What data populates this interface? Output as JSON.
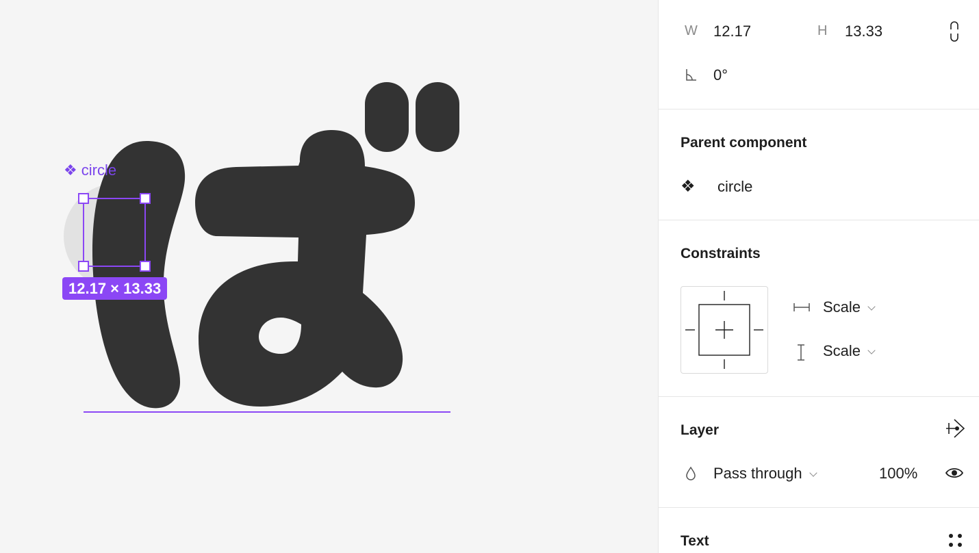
{
  "canvas": {
    "component_label": "circle",
    "dimension_badge": "12.17 × 13.33"
  },
  "panel": {
    "dimensions": {
      "w_label": "W",
      "w_value": "12.17",
      "h_label": "H",
      "h_value": "13.33",
      "rotation": "0°"
    },
    "parent_component": {
      "heading": "Parent component",
      "name": "circle"
    },
    "constraints": {
      "heading": "Constraints",
      "horizontal": "Scale",
      "vertical": "Scale"
    },
    "layer": {
      "heading": "Layer",
      "blend_mode": "Pass through",
      "opacity": "100%"
    },
    "text": {
      "heading": "Text"
    }
  },
  "colors": {
    "selection": "#8b47f5",
    "glyph": "#333333",
    "canvas": "#f5f5f5",
    "panel": "#ffffff"
  },
  "icons": [
    "component-icon",
    "rotation-icon",
    "constrain-proportions-icon",
    "horizontal-constraint-icon",
    "vertical-constraint-icon",
    "go-to-main-icon",
    "blend-mode-icon",
    "eye-icon",
    "text-options-icon"
  ]
}
